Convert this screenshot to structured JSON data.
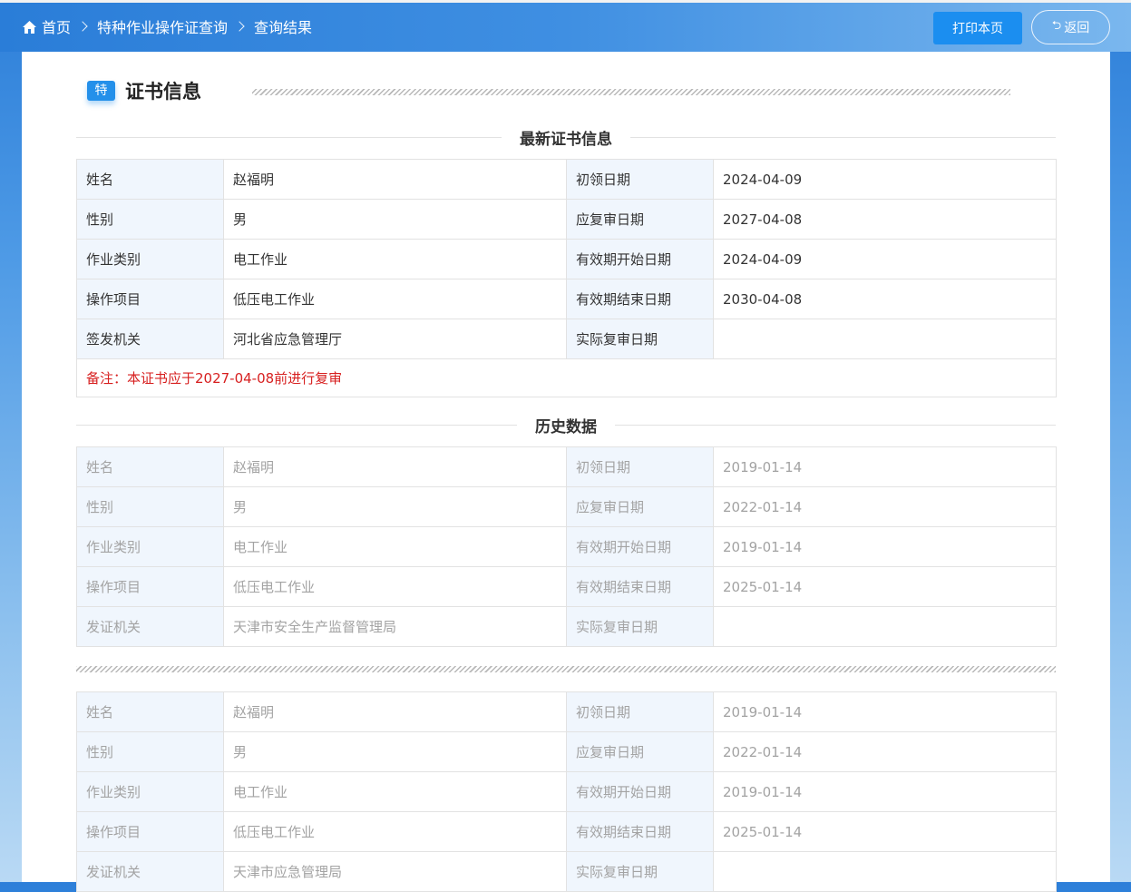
{
  "breadcrumb": {
    "home": "首页",
    "query": "特种作业操作证查询",
    "result": "查询结果"
  },
  "toolbar": {
    "print_label": "打印本页",
    "back_label": "返回"
  },
  "section": {
    "badge": "特",
    "title": "证书信息"
  },
  "current": {
    "title": "最新证书信息",
    "rows": [
      {
        "k1": "姓名",
        "v1": "赵福明",
        "k2": "初领日期",
        "v2": "2024-04-09"
      },
      {
        "k1": "性别",
        "v1": "男",
        "k2": "应复审日期",
        "v2": "2027-04-08"
      },
      {
        "k1": "作业类别",
        "v1": "电工作业",
        "k2": "有效期开始日期",
        "v2": "2024-04-09"
      },
      {
        "k1": "操作项目",
        "v1": "低压电工作业",
        "k2": "有效期结束日期",
        "v2": "2030-04-08"
      },
      {
        "k1": "签发机关",
        "v1": "河北省应急管理厅",
        "k2": "实际复审日期",
        "v2": ""
      }
    ],
    "remark": "备注：本证书应于2027-04-08前进行复审"
  },
  "history": {
    "title": "历史数据",
    "records": [
      {
        "rows": [
          {
            "k1": "姓名",
            "v1": "赵福明",
            "k2": "初领日期",
            "v2": "2019-01-14"
          },
          {
            "k1": "性别",
            "v1": "男",
            "k2": "应复审日期",
            "v2": "2022-01-14"
          },
          {
            "k1": "作业类别",
            "v1": "电工作业",
            "k2": "有效期开始日期",
            "v2": "2019-01-14"
          },
          {
            "k1": "操作项目",
            "v1": "低压电工作业",
            "k2": "有效期结束日期",
            "v2": "2025-01-14"
          },
          {
            "k1": "发证机关",
            "v1": "天津市安全生产监督管理局",
            "k2": "实际复审日期",
            "v2": ""
          }
        ]
      },
      {
        "rows": [
          {
            "k1": "姓名",
            "v1": "赵福明",
            "k2": "初领日期",
            "v2": "2019-01-14"
          },
          {
            "k1": "性别",
            "v1": "男",
            "k2": "应复审日期",
            "v2": "2022-01-14"
          },
          {
            "k1": "作业类别",
            "v1": "电工作业",
            "k2": "有效期开始日期",
            "v2": "2019-01-14"
          },
          {
            "k1": "操作项目",
            "v1": "低压电工作业",
            "k2": "有效期结束日期",
            "v2": "2025-01-14"
          },
          {
            "k1": "发证机关",
            "v1": "天津市应急管理局",
            "k2": "实际复审日期",
            "v2": ""
          }
        ]
      }
    ]
  }
}
